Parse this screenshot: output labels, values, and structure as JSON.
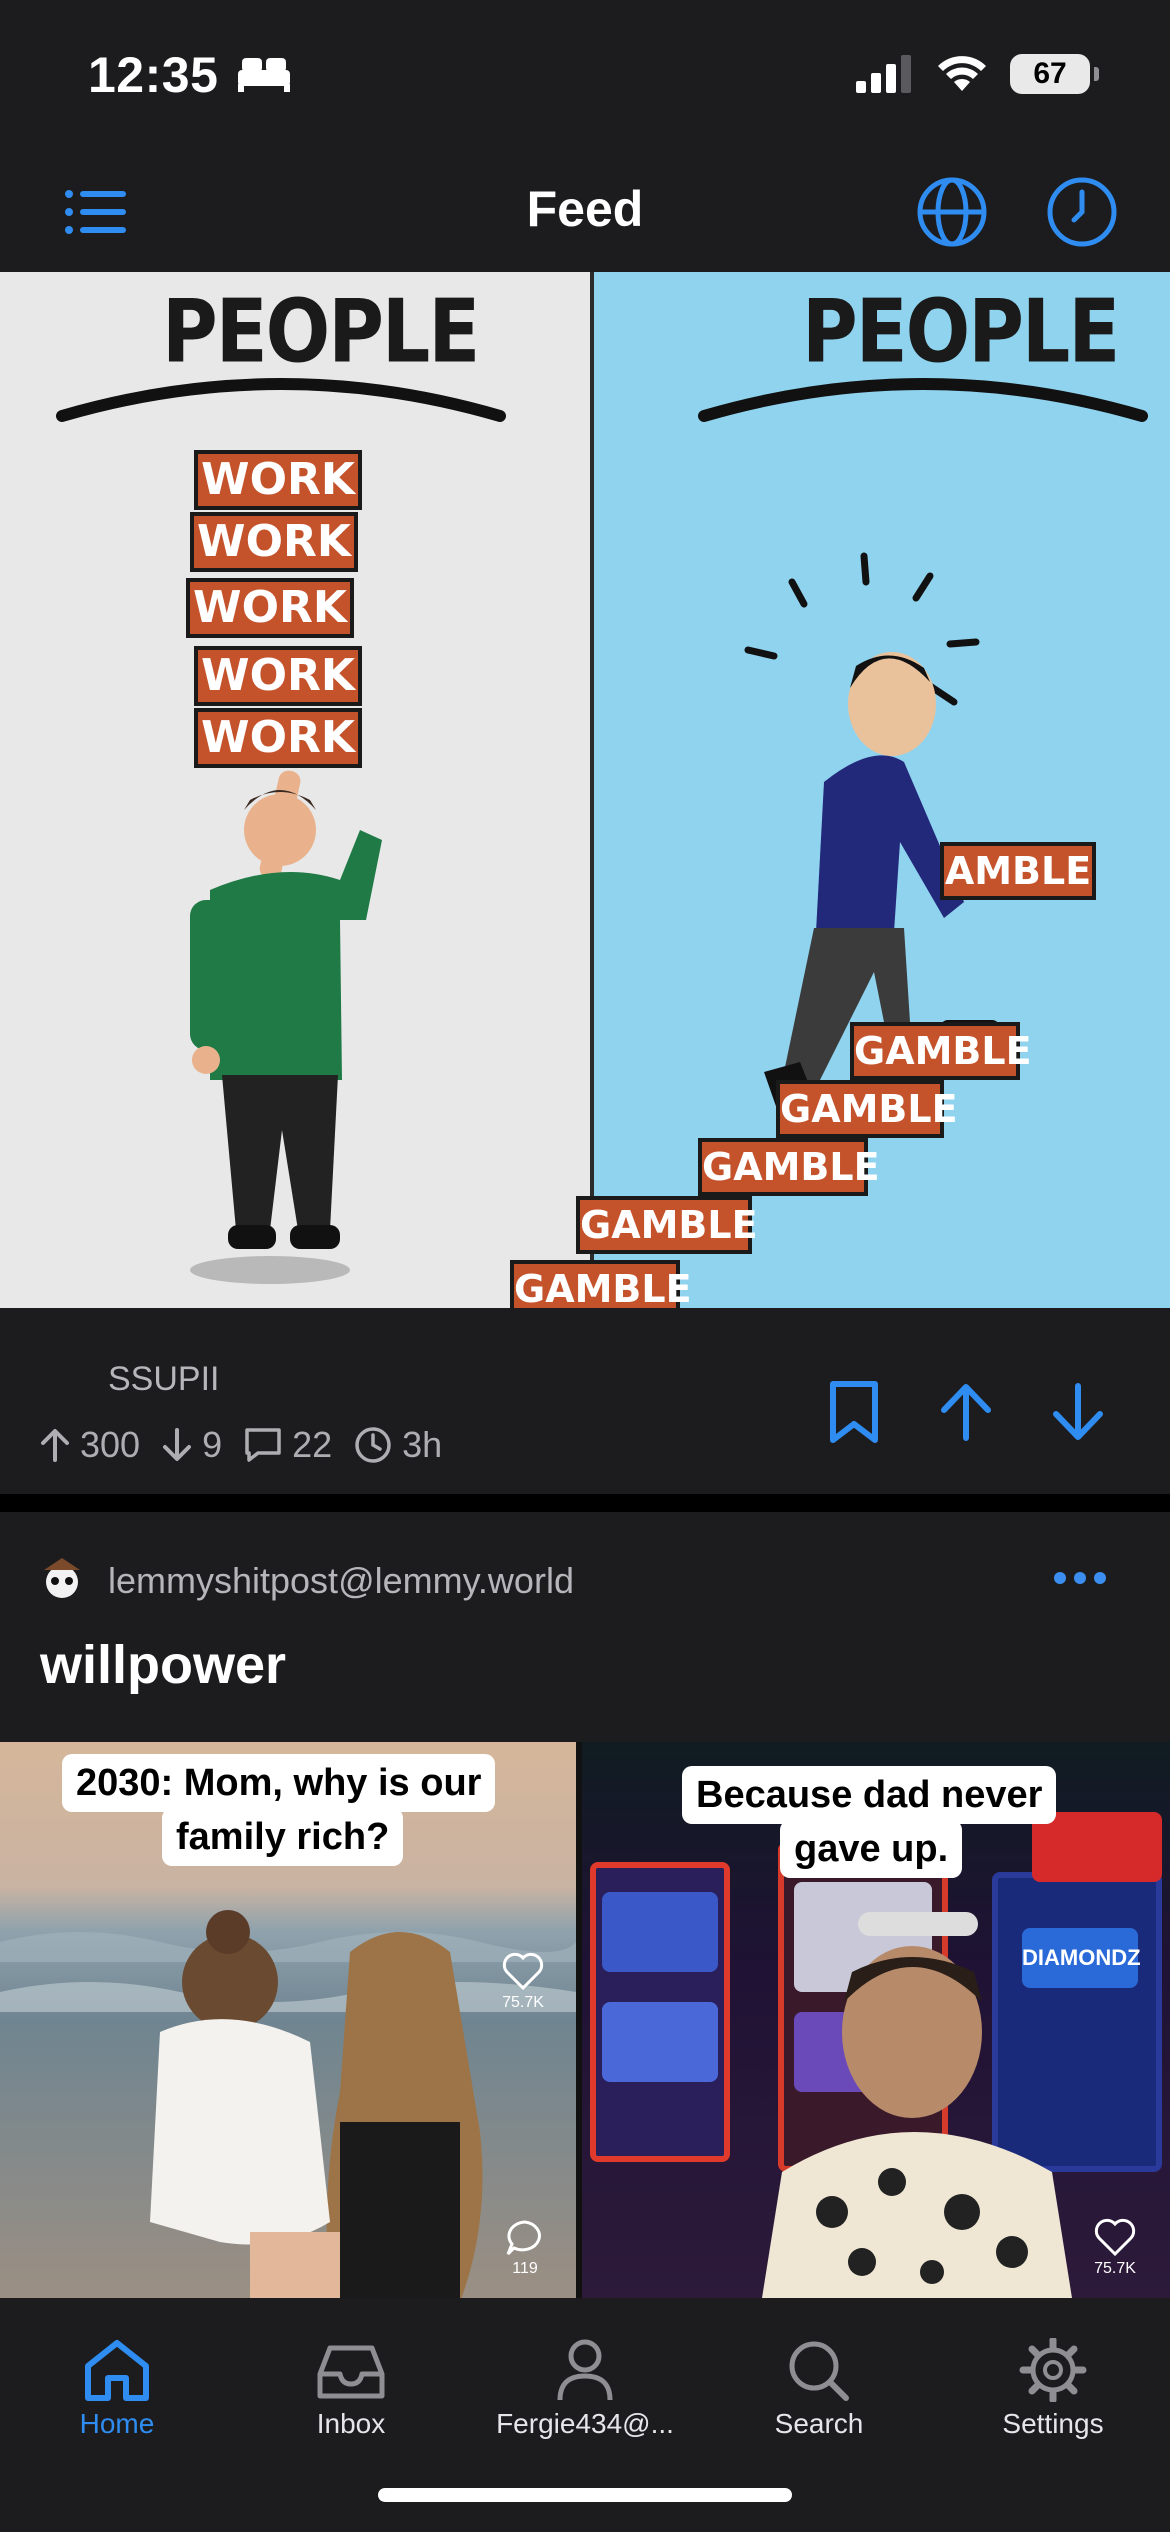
{
  "status_bar": {
    "time": "12:35",
    "battery": "67"
  },
  "nav": {
    "title": "Feed"
  },
  "post1": {
    "image": {
      "left_heading": "PEOPLE",
      "right_heading": "PEOPLE",
      "work_boxes": [
        "WORK",
        "WORK",
        "WORK",
        "WORK",
        "WORK"
      ],
      "held_box": "AMBLE",
      "steps": [
        "GAMBLE",
        "GAMBLE",
        "GAMBLE",
        "GAMBLE",
        "GAMBLE"
      ]
    },
    "community": "SSUPII",
    "upvotes": "300",
    "downvotes": "9",
    "comments": "22",
    "age": "3h"
  },
  "post2": {
    "community": "lemmyshitpost@lemmy.world",
    "title": "willpower",
    "image": {
      "left_caption_line1": "2030: Mom, why is our",
      "left_caption_line2": "family rich?",
      "right_caption_line1": "Because dad never",
      "right_caption_line2": "gave up.",
      "left_likes": "75.7K",
      "left_comments": "119",
      "right_likes": "75.7K",
      "sign_1": "DIAMONDZ"
    }
  },
  "tabs": [
    {
      "label": "Home",
      "icon": "home-icon"
    },
    {
      "label": "Inbox",
      "icon": "inbox-icon"
    },
    {
      "label": "Fergie434@...",
      "icon": "person-icon"
    },
    {
      "label": "Search",
      "icon": "search-icon"
    },
    {
      "label": "Settings",
      "icon": "gear-icon"
    }
  ],
  "colors": {
    "accent": "#2f8cf0",
    "background": "#1c1c1e",
    "secondary_text": "#aeaeb2"
  }
}
